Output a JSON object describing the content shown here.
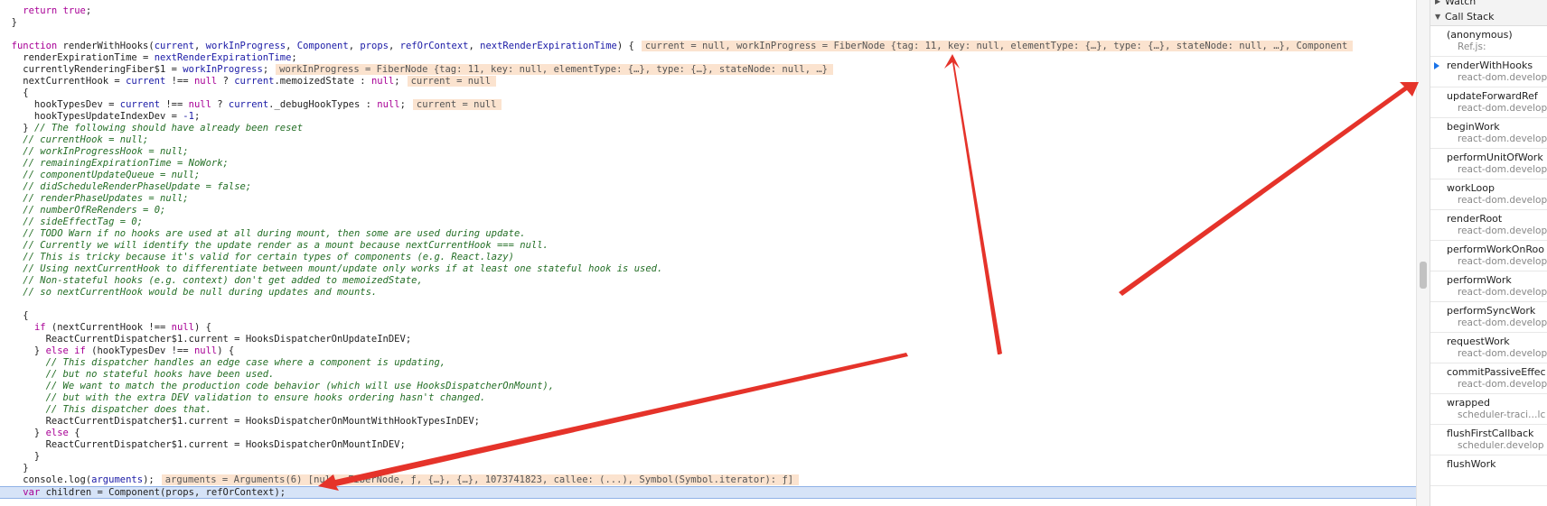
{
  "code_lines": [
    {
      "tokens": [
        {
          "t": "    ",
          "c": "p"
        },
        {
          "t": "return",
          "c": "k"
        },
        {
          "t": " ",
          "c": "p"
        },
        {
          "t": "true",
          "c": "k"
        },
        {
          "t": ";",
          "c": "p"
        }
      ]
    },
    {
      "tokens": [
        {
          "t": "  }",
          "c": "p"
        }
      ]
    },
    {
      "tokens": []
    },
    {
      "tokens": [
        {
          "t": "  ",
          "c": "p"
        },
        {
          "t": "function",
          "c": "k"
        },
        {
          "t": " renderWithHooks(",
          "c": "p"
        },
        {
          "t": "current",
          "c": "n"
        },
        {
          "t": ", ",
          "c": "p"
        },
        {
          "t": "workInProgress",
          "c": "n"
        },
        {
          "t": ", ",
          "c": "p"
        },
        {
          "t": "Component",
          "c": "n"
        },
        {
          "t": ", ",
          "c": "p"
        },
        {
          "t": "props",
          "c": "n"
        },
        {
          "t": ", ",
          "c": "p"
        },
        {
          "t": "refOrContext",
          "c": "n"
        },
        {
          "t": ", ",
          "c": "p"
        },
        {
          "t": "nextRenderExpirationTime",
          "c": "n"
        },
        {
          "t": ") {",
          "c": "p"
        }
      ],
      "inline": "current = null, workInProgress = FiberNode {tag: 11, key: null, elementType: {…}, type: {…}, stateNode: null, …}, Component"
    },
    {
      "tokens": [
        {
          "t": "    renderExpirationTime = ",
          "c": "p"
        },
        {
          "t": "nextRenderExpirationTime",
          "c": "n"
        },
        {
          "t": ";",
          "c": "p"
        }
      ]
    },
    {
      "tokens": [
        {
          "t": "    currentlyRenderingFiber$1 = ",
          "c": "p"
        },
        {
          "t": "workInProgress",
          "c": "n"
        },
        {
          "t": ";",
          "c": "p"
        }
      ],
      "inline": "workInProgress = FiberNode {tag: 11, key: null, elementType: {…}, type: {…}, stateNode: null, …}"
    },
    {
      "tokens": [
        {
          "t": "    nextCurrentHook = ",
          "c": "p"
        },
        {
          "t": "current",
          "c": "n"
        },
        {
          "t": " !== ",
          "c": "p"
        },
        {
          "t": "null",
          "c": "k"
        },
        {
          "t": " ? ",
          "c": "p"
        },
        {
          "t": "current",
          "c": "n"
        },
        {
          "t": ".memoizedState : ",
          "c": "p"
        },
        {
          "t": "null",
          "c": "k"
        },
        {
          "t": ";",
          "c": "p"
        }
      ],
      "inline": "current = null"
    },
    {
      "tokens": [
        {
          "t": "    {",
          "c": "p"
        }
      ]
    },
    {
      "tokens": [
        {
          "t": "      hookTypesDev = ",
          "c": "p"
        },
        {
          "t": "current",
          "c": "n"
        },
        {
          "t": " !== ",
          "c": "p"
        },
        {
          "t": "null",
          "c": "k"
        },
        {
          "t": " ? ",
          "c": "p"
        },
        {
          "t": "current",
          "c": "n"
        },
        {
          "t": "._debugHookTypes : ",
          "c": "p"
        },
        {
          "t": "null",
          "c": "k"
        },
        {
          "t": ";",
          "c": "p"
        }
      ],
      "inline": "current = null"
    },
    {
      "tokens": [
        {
          "t": "      hookTypesUpdateIndexDev = ",
          "c": "p"
        },
        {
          "t": "-1",
          "c": "num"
        },
        {
          "t": ";",
          "c": "p"
        }
      ]
    },
    {
      "tokens": [
        {
          "t": "    } ",
          "c": "p"
        },
        {
          "t": "// The following should have already been reset",
          "c": "c"
        }
      ]
    },
    {
      "tokens": [
        {
          "t": "    ",
          "c": "p"
        },
        {
          "t": "// currentHook = null;",
          "c": "c"
        }
      ]
    },
    {
      "tokens": [
        {
          "t": "    ",
          "c": "p"
        },
        {
          "t": "// workInProgressHook = null;",
          "c": "c"
        }
      ]
    },
    {
      "tokens": [
        {
          "t": "    ",
          "c": "p"
        },
        {
          "t": "// remainingExpirationTime = NoWork;",
          "c": "c"
        }
      ]
    },
    {
      "tokens": [
        {
          "t": "    ",
          "c": "p"
        },
        {
          "t": "// componentUpdateQueue = null;",
          "c": "c"
        }
      ]
    },
    {
      "tokens": [
        {
          "t": "    ",
          "c": "p"
        },
        {
          "t": "// didScheduleRenderPhaseUpdate = false;",
          "c": "c"
        }
      ]
    },
    {
      "tokens": [
        {
          "t": "    ",
          "c": "p"
        },
        {
          "t": "// renderPhaseUpdates = null;",
          "c": "c"
        }
      ]
    },
    {
      "tokens": [
        {
          "t": "    ",
          "c": "p"
        },
        {
          "t": "// numberOfReRenders = 0;",
          "c": "c"
        }
      ]
    },
    {
      "tokens": [
        {
          "t": "    ",
          "c": "p"
        },
        {
          "t": "// sideEffectTag = 0;",
          "c": "c"
        }
      ]
    },
    {
      "tokens": [
        {
          "t": "    ",
          "c": "p"
        },
        {
          "t": "// TODO Warn if no hooks are used at all during mount, then some are used during update.",
          "c": "c"
        }
      ]
    },
    {
      "tokens": [
        {
          "t": "    ",
          "c": "p"
        },
        {
          "t": "// Currently we will identify the update render as a mount because nextCurrentHook === null.",
          "c": "c"
        }
      ]
    },
    {
      "tokens": [
        {
          "t": "    ",
          "c": "p"
        },
        {
          "t": "// This is tricky because it's valid for certain types of components (e.g. React.lazy)",
          "c": "c"
        }
      ]
    },
    {
      "tokens": [
        {
          "t": "    ",
          "c": "p"
        },
        {
          "t": "// Using nextCurrentHook to differentiate between mount/update only works if at least one stateful hook is used.",
          "c": "c"
        }
      ]
    },
    {
      "tokens": [
        {
          "t": "    ",
          "c": "p"
        },
        {
          "t": "// Non-stateful hooks (e.g. context) don't get added to memoizedState,",
          "c": "c"
        }
      ]
    },
    {
      "tokens": [
        {
          "t": "    ",
          "c": "p"
        },
        {
          "t": "// so nextCurrentHook would be null during updates and mounts.",
          "c": "c"
        }
      ]
    },
    {
      "tokens": []
    },
    {
      "tokens": [
        {
          "t": "    {",
          "c": "p"
        }
      ]
    },
    {
      "tokens": [
        {
          "t": "      ",
          "c": "p"
        },
        {
          "t": "if",
          "c": "k"
        },
        {
          "t": " (nextCurrentHook !== ",
          "c": "p"
        },
        {
          "t": "null",
          "c": "k"
        },
        {
          "t": ") {",
          "c": "p"
        }
      ]
    },
    {
      "tokens": [
        {
          "t": "        ReactCurrentDispatcher$1.current = HooksDispatcherOnUpdateInDEV;",
          "c": "p"
        }
      ]
    },
    {
      "tokens": [
        {
          "t": "      } ",
          "c": "p"
        },
        {
          "t": "else if",
          "c": "k"
        },
        {
          "t": " (hookTypesDev !== ",
          "c": "p"
        },
        {
          "t": "null",
          "c": "k"
        },
        {
          "t": ") {",
          "c": "p"
        }
      ]
    },
    {
      "tokens": [
        {
          "t": "        ",
          "c": "p"
        },
        {
          "t": "// This dispatcher handles an edge case where a component is updating,",
          "c": "c"
        }
      ]
    },
    {
      "tokens": [
        {
          "t": "        ",
          "c": "p"
        },
        {
          "t": "// but no stateful hooks have been used.",
          "c": "c"
        }
      ]
    },
    {
      "tokens": [
        {
          "t": "        ",
          "c": "p"
        },
        {
          "t": "// We want to match the production code behavior (which will use HooksDispatcherOnMount),",
          "c": "c"
        }
      ]
    },
    {
      "tokens": [
        {
          "t": "        ",
          "c": "p"
        },
        {
          "t": "// but with the extra DEV validation to ensure hooks ordering hasn't changed.",
          "c": "c"
        }
      ]
    },
    {
      "tokens": [
        {
          "t": "        ",
          "c": "p"
        },
        {
          "t": "// This dispatcher does that.",
          "c": "c"
        }
      ]
    },
    {
      "tokens": [
        {
          "t": "        ReactCurrentDispatcher$1.current = HooksDispatcherOnMountWithHookTypesInDEV;",
          "c": "p"
        }
      ]
    },
    {
      "tokens": [
        {
          "t": "      } ",
          "c": "p"
        },
        {
          "t": "else",
          "c": "k"
        },
        {
          "t": " {",
          "c": "p"
        }
      ]
    },
    {
      "tokens": [
        {
          "t": "        ReactCurrentDispatcher$1.current = HooksDispatcherOnMountInDEV;",
          "c": "p"
        }
      ]
    },
    {
      "tokens": [
        {
          "t": "      }",
          "c": "p"
        }
      ]
    },
    {
      "tokens": [
        {
          "t": "    }",
          "c": "p"
        }
      ]
    },
    {
      "tokens": [
        {
          "t": "    console.log(",
          "c": "p"
        },
        {
          "t": "arguments",
          "c": "n"
        },
        {
          "t": ");",
          "c": "p"
        }
      ],
      "inline": "arguments = Arguments(6) [null, FiberNode, ƒ, {…}, {…}, 1073741823, callee: (...), Symbol(Symbol.iterator): ƒ]"
    },
    {
      "tokens": [
        {
          "t": "    ",
          "c": "p"
        },
        {
          "t": "var",
          "c": "k"
        },
        {
          "t": " children = Component(props, refOrContext);",
          "c": "p"
        }
      ],
      "exec": true
    }
  ],
  "sidebar": {
    "watch_label": "Watch",
    "call_stack_label": "Call Stack",
    "frames": [
      {
        "name": "(anonymous)",
        "location": "Ref.js:",
        "current": false
      },
      {
        "name": "renderWithHooks",
        "location": "react-dom.develop",
        "current": true
      },
      {
        "name": "updateForwardRef",
        "location": "react-dom.develop",
        "current": false
      },
      {
        "name": "beginWork",
        "location": "react-dom.develop",
        "current": false
      },
      {
        "name": "performUnitOfWork",
        "location": "react-dom.develop",
        "current": false
      },
      {
        "name": "workLoop",
        "location": "react-dom.develop",
        "current": false
      },
      {
        "name": "renderRoot",
        "location": "react-dom.develop",
        "current": false
      },
      {
        "name": "performWorkOnRoo",
        "location": "react-dom.develop",
        "current": false
      },
      {
        "name": "performWork",
        "location": "react-dom.develop",
        "current": false
      },
      {
        "name": "performSyncWork",
        "location": "react-dom.develop",
        "current": false
      },
      {
        "name": "requestWork",
        "location": "react-dom.develop",
        "current": false
      },
      {
        "name": "commitPassiveEffec",
        "location": "react-dom.develop",
        "current": false
      },
      {
        "name": "wrapped",
        "location": "scheduler-traci…lc",
        "current": false
      },
      {
        "name": "flushFirstCallback",
        "location": "scheduler.develop",
        "current": false
      },
      {
        "name": "flushWork",
        "location": "",
        "current": false
      }
    ]
  },
  "colors": {
    "keyword": "#a80096",
    "identifier": "#1a1aa6",
    "comment": "#236e25",
    "inline_value_bg": "#fbe3cf",
    "exec_line_bg": "#d6e3f7",
    "arrow": "#e5332a",
    "stack_pointer": "#1a73e8"
  }
}
